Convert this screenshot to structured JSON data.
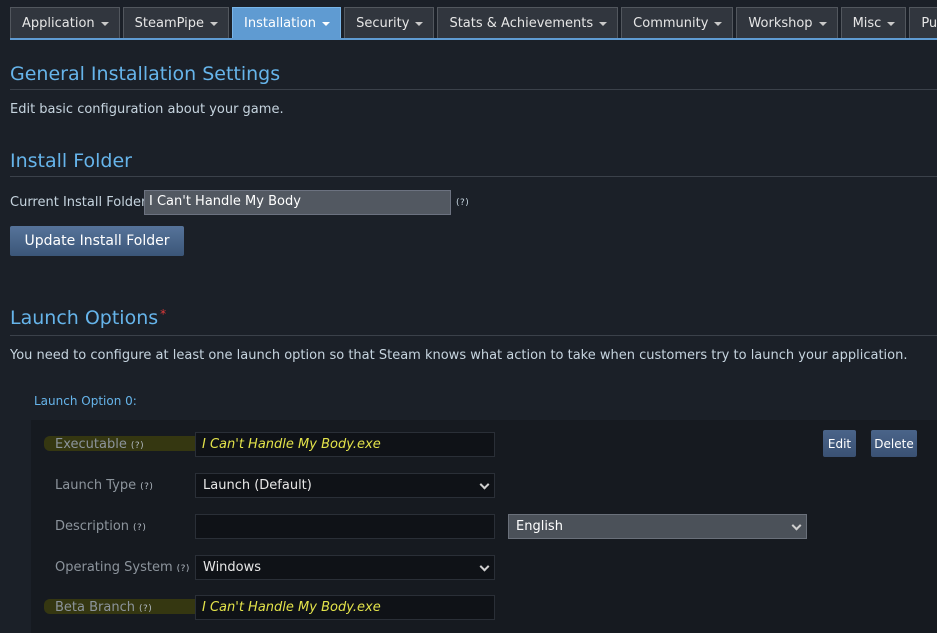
{
  "tabs": [
    {
      "label": "Application",
      "active": false
    },
    {
      "label": "SteamPipe",
      "active": false
    },
    {
      "label": "Installation",
      "active": true
    },
    {
      "label": "Security",
      "active": false
    },
    {
      "label": "Stats & Achievements",
      "active": false
    },
    {
      "label": "Community",
      "active": false
    },
    {
      "label": "Workshop",
      "active": false
    },
    {
      "label": "Misc",
      "active": false
    },
    {
      "label": "Publish",
      "active": false
    }
  ],
  "general": {
    "title": "General Installation Settings",
    "description": "Edit basic configuration about your game."
  },
  "install_folder": {
    "title": "Install Folder",
    "label": "Current Install Folder:",
    "value": "I Can't Handle My Body",
    "help": "(?)",
    "button": "Update Install Folder"
  },
  "launch_options": {
    "title": "Launch Options",
    "required_mark": "*",
    "description": "You need to configure at least one launch option so that Steam knows what action to take when customers try to launch your application.",
    "option_title": "Launch Option 0:",
    "executable_label": "Executable",
    "executable_value": "I Can't Handle My Body.exe",
    "launch_type_label": "Launch Type",
    "launch_type_value": "Launch (Default)",
    "description_label": "Description",
    "description_value": "",
    "language_value": "English",
    "os_label": "Operating System",
    "os_value": "Windows",
    "beta_label": "Beta Branch",
    "beta_value": "I Can't Handle My Body.exe",
    "help": "(?)",
    "edit_button": "Edit",
    "delete_button": "Delete"
  },
  "colors": {
    "accent": "#66b4ea",
    "active_tab": "#5f9bd2",
    "highlight_text": "#e3e34a"
  }
}
